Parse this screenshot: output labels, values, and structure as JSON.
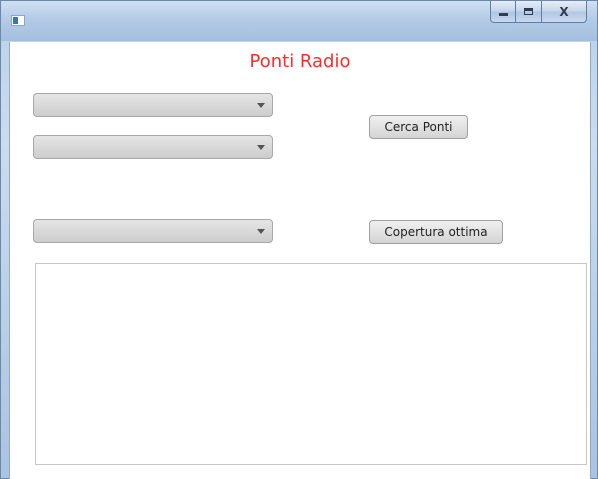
{
  "window": {
    "title": "",
    "icon": "app-window-icon",
    "controls": {
      "minimize_icon": "minimize-icon",
      "maximize_icon": "maximize-icon",
      "close_label": "X"
    }
  },
  "main": {
    "heading": "Ponti Radio",
    "heading_color": "#ff2a2a",
    "combo_1": {
      "selected": ""
    },
    "combo_2": {
      "selected": ""
    },
    "combo_3": {
      "selected": ""
    },
    "search_button_label": "Cerca Ponti",
    "coverage_button_label": "Copertura ottima",
    "output_text": ""
  }
}
